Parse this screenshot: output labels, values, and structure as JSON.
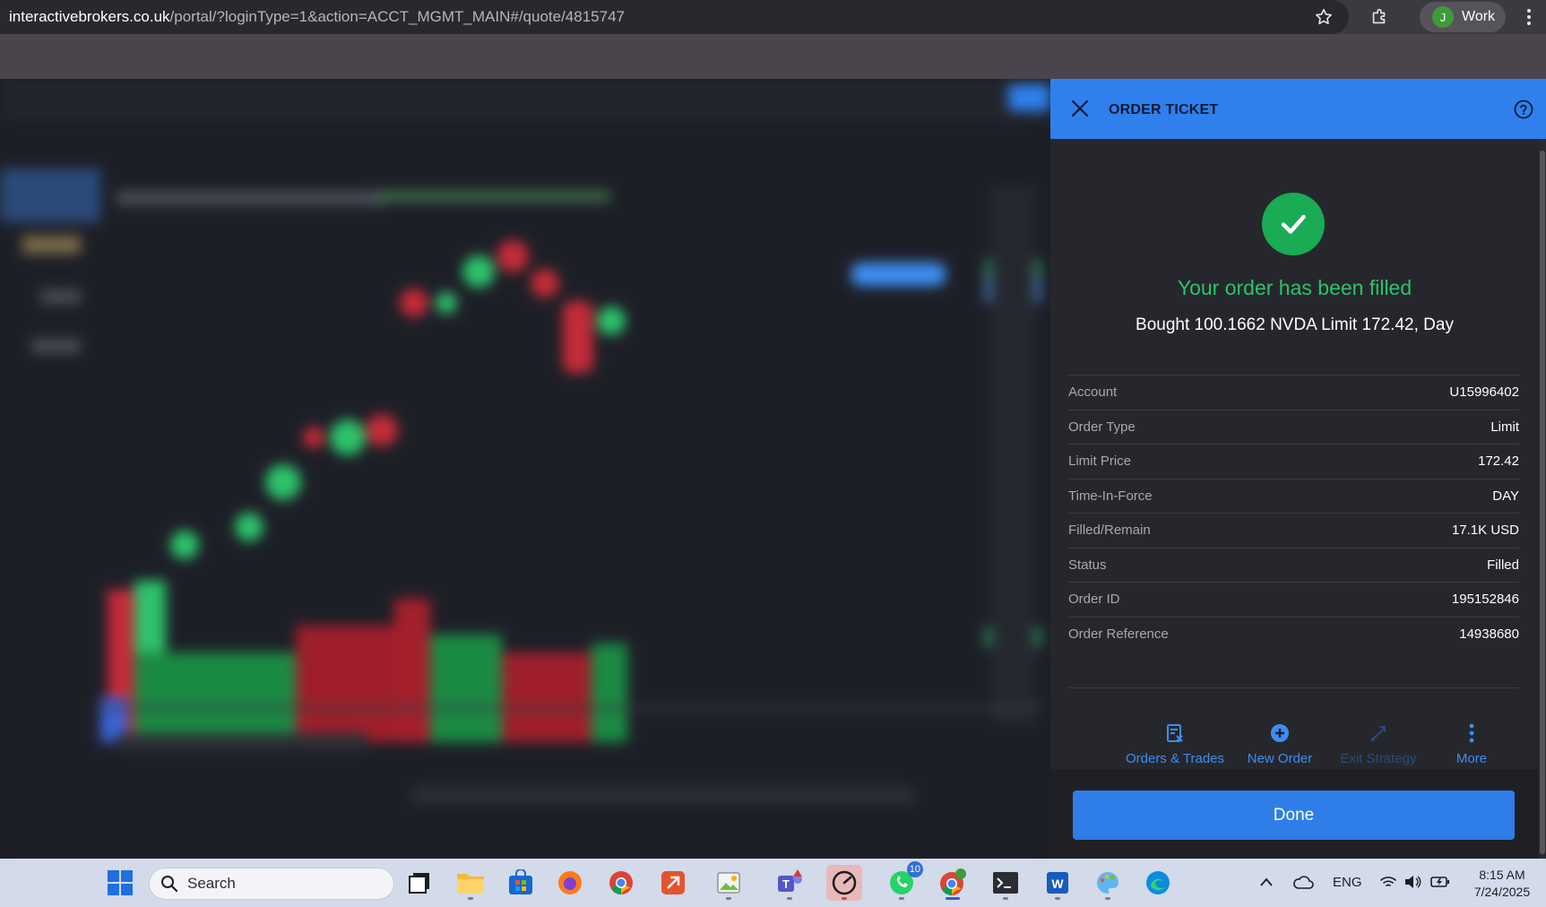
{
  "browser": {
    "url_host": "interactivebrokers.co.uk",
    "url_path": "/portal/?loginType=1&action=ACCT_MGMT_MAIN#/quote/4815747",
    "profile": {
      "initial": "J",
      "label": "Work"
    },
    "icons": [
      "star-icon",
      "extensions-icon",
      "kebab-menu-icon"
    ]
  },
  "ticket": {
    "title": "ORDER TICKET",
    "icons": [
      "close-icon",
      "help-icon",
      "check-icon"
    ],
    "heading": "Your order has been filled",
    "summary": "Bought 100.1662 NVDA Limit 172.42, Day",
    "details": [
      {
        "label": "Account",
        "value": "U15996402"
      },
      {
        "label": "Order Type",
        "value": "Limit"
      },
      {
        "label": "Limit Price",
        "value": "172.42"
      },
      {
        "label": "Time-In-Force",
        "value": "DAY"
      },
      {
        "label": "Filled/Remain",
        "value": "17.1K USD"
      },
      {
        "label": "Status",
        "value": "Filled"
      },
      {
        "label": "Order ID",
        "value": "195152846"
      },
      {
        "label": "Order Reference",
        "value": "14938680"
      }
    ],
    "actions": [
      {
        "label": "Orders & Trades",
        "icon": "orders-trades-icon",
        "enabled": true
      },
      {
        "label": "New Order",
        "icon": "plus-circle-icon",
        "enabled": true
      },
      {
        "label": "Exit Strategy",
        "icon": "exit-strategy-icon",
        "enabled": false
      },
      {
        "label": "More",
        "icon": "more-vertical-icon",
        "enabled": true
      }
    ],
    "done_label": "Done",
    "colors": {
      "header": "#2f80ed",
      "success": "#1aab55",
      "accent": "#3d8ef0",
      "panel": "#26272c"
    }
  },
  "taskbar": {
    "search_placeholder": "Search",
    "apps": [
      "windows-start-icon",
      "task-view-icon",
      "file-explorer-icon",
      "ms-store-icon",
      "firefox-icon",
      "chrome-icon",
      "remote-app-icon",
      "image-app-icon",
      "teams-icon",
      "speedtest-icon",
      "whatsapp-icon",
      "chrome-profile-icon",
      "terminal-icon",
      "word-icon",
      "paint-icon",
      "edge-icon"
    ],
    "whatsapp_badge": "10",
    "tray": {
      "language": "ENG",
      "time": "8:15 AM",
      "date": "7/24/2025"
    }
  }
}
